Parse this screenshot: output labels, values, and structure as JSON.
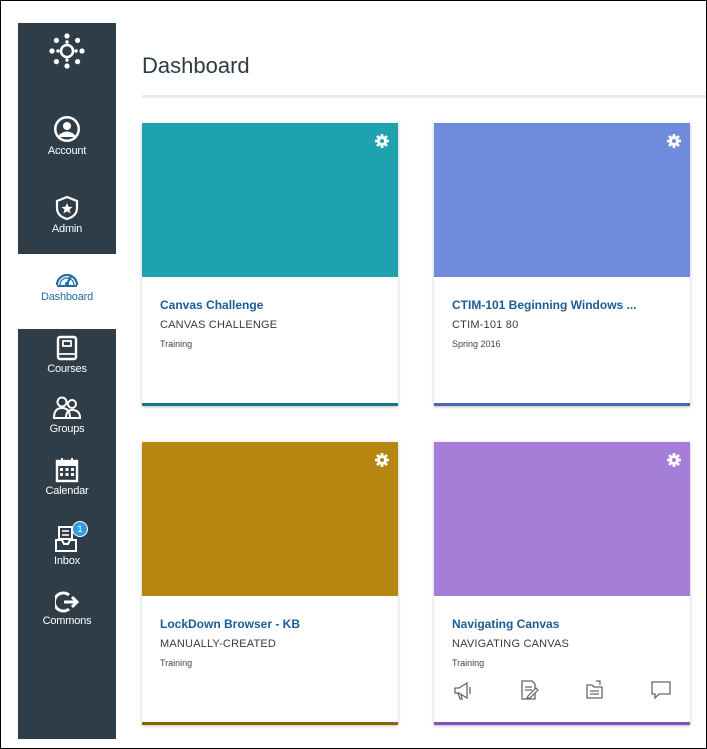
{
  "page": {
    "title": "Dashboard"
  },
  "nav": {
    "items": [
      {
        "label": "Account"
      },
      {
        "label": "Admin"
      },
      {
        "label": "Dashboard"
      },
      {
        "label": "Courses"
      },
      {
        "label": "Groups"
      },
      {
        "label": "Calendar"
      },
      {
        "label": "Inbox",
        "badge": "1"
      },
      {
        "label": "Commons"
      }
    ]
  },
  "colors": {
    "nav_bg": "#2f3d48",
    "active_text": "#1f6ea6",
    "card1": "#1fa2b0",
    "card2": "#6f8bdc",
    "card3": "#b58710",
    "card4": "#a57ed8"
  },
  "cards": [
    {
      "name": "Canvas Challenge",
      "code": "CANVAS CHALLENGE",
      "term": "Training"
    },
    {
      "name": "CTIM-101 Beginning Windows ...",
      "code": "CTIM-101 80",
      "term": "Spring 2016"
    },
    {
      "name": "LockDown Browser - KB",
      "code": "MANUALLY-CREATED",
      "term": "Training"
    },
    {
      "name": "Navigating Canvas",
      "code": "NAVIGATING CANVAS",
      "term": "Training",
      "actions": [
        "announcements-icon",
        "assignments-icon",
        "files-icon",
        "discussions-icon"
      ]
    }
  ]
}
